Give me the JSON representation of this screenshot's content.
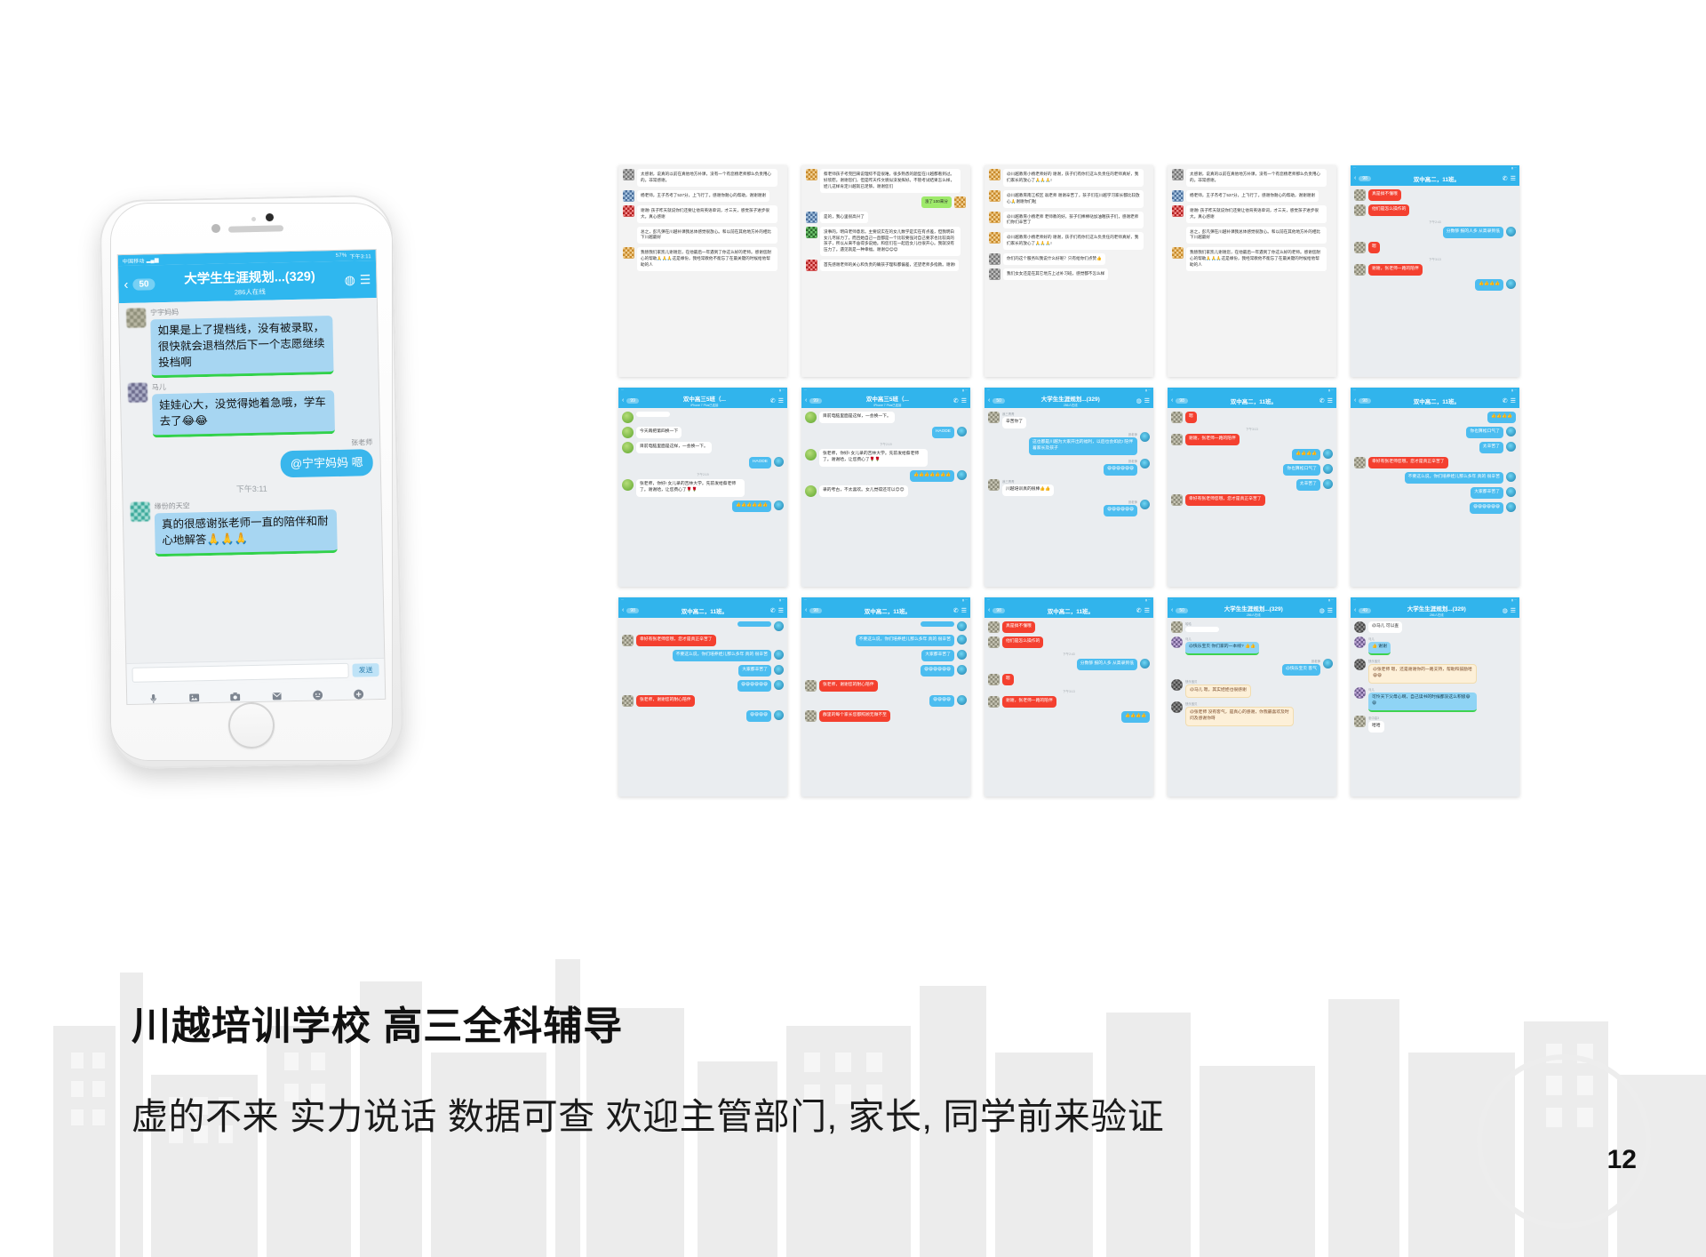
{
  "slide": {
    "headline": "川越培训学校 高三全科辅导",
    "subline": "虚的不来 实力说话 数据可查 欢迎主管部门, 家长, 同学前来验证",
    "page_number": "12",
    "accent_blue": "#2fb7ef",
    "bubble_red": "#f4402f",
    "bubble_green": "#32d14a"
  },
  "phone": {
    "status": {
      "carrier": "中国移动",
      "battery": "57%",
      "time": "下午3:11"
    },
    "nav": {
      "back_icon": "chevron-left",
      "badge": "50",
      "title": "大学生生涯规划...(329)",
      "subtitle": "286人在线",
      "right_icon_1": "leaf-icon",
      "right_icon_2": "menu-icon"
    },
    "messages": [
      {
        "side": "left",
        "name": "宁宇妈妈",
        "text": "如果是上了提档线，没有被录取，很快就会退档然后下一个志愿继续投档啊"
      },
      {
        "side": "left",
        "name": "马儿",
        "text": "娃娃心大，没觉得她着急哦，学车去了😂😂"
      },
      {
        "side": "right",
        "name": "张老师",
        "text": "@宁宇妈妈 嗯"
      },
      {
        "side": "time",
        "text": "下午3:11"
      },
      {
        "side": "left",
        "name": "缘份的天空",
        "text": "真的很感谢张老师一直的陪伴和耐心地解答🙏🙏🙏"
      }
    ],
    "input": {
      "placeholder": "",
      "send_label": "发送"
    },
    "toolbar_icons": [
      "mic-icon",
      "image-icon",
      "camera-icon",
      "envelope-icon",
      "smiley-icon",
      "plus-icon"
    ]
  },
  "grid": {
    "row1": [
      {
        "type": "white",
        "bubbles": [
          {
            "av": "gy",
            "text": "太感谢，说真的以前在真他地方补课，没有一个有您杨老师那么负责用心的。非常感谢。"
          },
          {
            "av": "bl",
            "text": "杨老师，王子杰考了537分，上飞行了。感谢你耐心的帮助，谢谢谢谢"
          },
          {
            "av": "r",
            "text": "谢谢! 孩子昨天就说你们还要让他背英语单词，才三天，感觉孩子进步很大。真心感谢"
          },
          {
            "av": "none",
            "text": "总之，彭凡彈在川越补课我总体感觉很放心。和以前在其他地方补的相比下川越最好"
          },
          {
            "av": "o",
            "text": "我替我们家凯儿谢谢您，在他最后一年遇到了你这么好的老师。感谢您耐心的帮助🙏🙏🙏这是缘份，我经常教他不能忘了在最关键的时候给他帮助的人"
          }
        ]
      },
      {
        "type": "white",
        "bubbles": [
          {
            "av": "o",
            "text": "蔡老师孩子考完回来说理综不是很难，很多熟悉的题型在川越都看到过。好欣慰。谢谢您们，但是昨天作文貌似没发挥好。不管考试结果怎么样，娃儿这样肯定川越就已足够。谢谢您们"
          },
          {
            "av": "none",
            "side": "right",
            "green": true,
            "text": "涨了100来分"
          },
          {
            "av": "bl",
            "text": "是的，我心里很高兴了"
          },
          {
            "av": "g",
            "text": "没事的，明白老师意思。主要说实在的女儿数学是实在有点差，但我明白女儿尽尿力了。而且她自己一直都是一个比较要强对自己要求也比较高的孩子，所以从来不舍得多说她。和您们在一起后女儿也很开心。我就没有压力了。遇见就是一种幸福。谢谢😊😊😊"
          },
          {
            "av": "r",
            "text": "首先感谢老师的关心和负责的确孩子理科都偏差，还望老师多指教。谢谢!"
          }
        ]
      },
      {
        "type": "white",
        "bubbles": [
          {
            "av": "o",
            "text": "@川越教育小杨老师好的 谢谢，孩子们有你们这么负责任的老师真好，我们家长的放心了🙏🙏🙏!"
          },
          {
            "av": "o",
            "text": "@川越教育南江校区 翁老师 谢谢辛苦了，孩子们在川越学习家长都比较放心🙏谢谢你们啦"
          },
          {
            "av": "o",
            "text": "@川越教育小杨老师 老师教的好，孩子们棒棒哒加油喔孩子们，感谢老师们你们辛苦了"
          },
          {
            "av": "o",
            "text": "@川越教育小杨老师好的 谢谢，孩子们有你们这么负责任的老师真好，我们家长的放心了🙏🙏🙏!"
          },
          {
            "av": "gy",
            "text": "你们的这个服务叫我说什么好呢？只有给你们点赞👍"
          },
          {
            "av": "gy",
            "text": "我们女女还是在其它地方上过补习班，感觉都不怎么样"
          }
        ]
      },
      {
        "type": "white",
        "bubbles": [
          {
            "av": "gy",
            "text": "太感谢，说真的以前在真他地方补课，没有一个有您杨老师那么负责用心的。非常感谢。"
          },
          {
            "av": "bl",
            "text": "杨老师，王子杰考了537分，上飞行了。感谢你耐心的帮助，谢谢谢谢"
          },
          {
            "av": "r",
            "text": "谢谢! 孩子昨天就说你们还要让他背英语单词，才三天，感觉孩子进步很大。真心感谢"
          },
          {
            "av": "none",
            "text": "总之，彭凡彈在川越补课我总体感觉很放心。和以前在其他地方补的相比下川越最好"
          },
          {
            "av": "o",
            "text": "我替我们家凯儿谢谢您，在他最后一年遇到了你这么好的老师。感谢您耐心的帮助🙏🙏🙏这是缘份，我经常教他不能忘了在最关键的时候给他帮助的人"
          }
        ]
      },
      {
        "type": "blue",
        "nav": {
          "badge": "98",
          "title": "双中高二，11班。",
          "sub": "",
          "ic1": "phone-icon",
          "ic2": "menu-icon"
        },
        "msgs": [
          {
            "s": "l",
            "style": "red",
            "av": "def",
            "text": "真是搞不懂哦"
          },
          {
            "s": "l",
            "style": "red",
            "av": "def",
            "text": "他们是怎么操作的"
          },
          {
            "s": "t",
            "text": "下午2:43"
          },
          {
            "s": "r",
            "style": "blue",
            "seal": true,
            "text": "分数够 报的人多 从高录到低"
          },
          {
            "s": "l",
            "style": "red",
            "av": "def",
            "text": "嗯"
          },
          {
            "s": "t",
            "text": "下午3:13"
          },
          {
            "s": "l",
            "style": "red",
            "av": "def",
            "text": "谢谢，张老师一路的陪伴"
          },
          {
            "s": "r",
            "style": "blue",
            "seal": true,
            "text": "👍👍👍👍"
          }
        ]
      }
    ],
    "row2": [
      {
        "type": "blue",
        "nav": {
          "badge": "99",
          "title": "双中高三5班（...",
          "sub": "iPhone 7 Plus已连接",
          "ic1": "phone-icon",
          "ic2": "menu-icon"
        },
        "msgs": [
          {
            "s": "l",
            "style": "white",
            "av": "leaf",
            "text": ""
          },
          {
            "s": "l",
            "style": "white",
            "av": "leaf",
            "text": "今天再把第四换一下"
          },
          {
            "s": "l",
            "style": "white",
            "av": "leaf",
            "text": "目前电脑里面是这样，一会换一下。"
          },
          {
            "s": "r",
            "style": "blue",
            "seal": true,
            "text": "HAODE"
          },
          {
            "s": "t",
            "text": "下午2:19"
          },
          {
            "s": "l",
            "style": "white",
            "av": "leaf",
            "text": "张老师，你好! 女儿录的吉林大学。先前发给蔡老师了。谢谢哈，让您费心了🌹🌹"
          },
          {
            "s": "r",
            "style": "blue",
            "seal": true,
            "text": "👍👍👍👍👍👍"
          }
        ]
      },
      {
        "type": "blue",
        "nav": {
          "badge": "99",
          "title": "双中高三5班（...",
          "sub": "iPhone 7 Plus已连接",
          "ic1": "phone-icon",
          "ic2": "menu-icon"
        },
        "msgs": [
          {
            "s": "l",
            "style": "white",
            "av": "leaf",
            "text": "目前电脑里面是这样，一会换一下。"
          },
          {
            "s": "r",
            "style": "blue",
            "seal": true,
            "text": "HAODE"
          },
          {
            "s": "t",
            "text": "下午2:19"
          },
          {
            "s": "l",
            "style": "white",
            "av": "leaf",
            "text": "张老师，你好! 女儿录的吉林大学。先前发给蔡老师了。谢谢哈，让您费心了🌹🌹"
          },
          {
            "s": "r",
            "style": "blue",
            "seal": true,
            "text": "👍👍👍👍👍👍👍"
          },
          {
            "s": "l",
            "style": "white",
            "av": "leaf",
            "text": "录的考古，不太喜欢。女儿觉得还可以😊😊"
          }
        ]
      },
      {
        "type": "blue",
        "nav": {
          "badge": "50",
          "title": "大学生生涯规划...(329)",
          "sub": "286人在线",
          "ic1": "leaf-icon",
          "ic2": "menu-icon"
        },
        "msgs": [
          {
            "s": "l",
            "style": "white",
            "av": "def",
            "nm": "我三青青",
            "text": "辛苦你了"
          },
          {
            "s": "r",
            "style": "blue",
            "nm": "张老师",
            "seal": true,
            "text": "这也都是川越为大家开出的福利，以后也会如此! 陪伴着家长及孩子"
          },
          {
            "s": "r",
            "style": "blue",
            "nm": "张老师",
            "seal": true,
            "text": "😄😄😄😄😄😄"
          },
          {
            "s": "l",
            "style": "white",
            "av": "def",
            "nm": "我三青青",
            "text": "川越培训真的很棒👍👍"
          },
          {
            "s": "r",
            "style": "blue",
            "nm": "张老师",
            "seal": true,
            "text": "😄😄😄😄😄😄"
          }
        ]
      },
      {
        "type": "blue",
        "nav": {
          "badge": "98",
          "title": "双中高二，11班。",
          "sub": "",
          "ic1": "phone-icon",
          "ic2": "menu-icon"
        },
        "msgs": [
          {
            "s": "l",
            "style": "red",
            "av": "def",
            "text": "嗯"
          },
          {
            "s": "t",
            "text": "下午3:13"
          },
          {
            "s": "l",
            "style": "red",
            "av": "def",
            "text": "谢谢，张老师一路的陪伴"
          },
          {
            "s": "r",
            "style": "blue",
            "seal": true,
            "text": "👍👍👍👍"
          },
          {
            "s": "r",
            "style": "blue",
            "seal": true,
            "text": "你也算松口气了"
          },
          {
            "s": "r",
            "style": "blue",
            "seal": true,
            "text": "太辛苦了"
          },
          {
            "s": "l",
            "style": "red",
            "av": "def",
            "text": "幸好有张老师您哦，您才是真正辛苦了"
          }
        ]
      },
      {
        "type": "blue",
        "nav": {
          "badge": "98",
          "title": "双中高二，11班。",
          "sub": "",
          "ic1": "phone-icon",
          "ic2": "menu-icon"
        },
        "msgs": [
          {
            "s": "r",
            "style": "blue",
            "seal": false,
            "text": "👍👍👍👍"
          },
          {
            "s": "r",
            "style": "blue",
            "seal": true,
            "text": "你也算松口气了"
          },
          {
            "s": "r",
            "style": "blue",
            "seal": true,
            "text": "太辛苦了"
          },
          {
            "s": "l",
            "style": "red",
            "av": "def",
            "text": "幸好有张老师您哦，您才是真正辛苦了"
          },
          {
            "s": "r",
            "style": "blue",
            "seal": true,
            "text": "不要这么说，你们培养娃儿那么多年 真的 很辛苦"
          },
          {
            "s": "r",
            "style": "blue",
            "seal": true,
            "text": "大家都辛苦了"
          },
          {
            "s": "r",
            "style": "blue",
            "seal": true,
            "text": "😄😄😄😄😄😄"
          }
        ]
      }
    ],
    "row3": [
      {
        "type": "blue",
        "nav": {
          "badge": "98",
          "title": "双中高二，11班。",
          "sub": "",
          "ic1": "phone-icon",
          "ic2": "menu-icon"
        },
        "msgs": [
          {
            "s": "r",
            "style": "blue",
            "seal": true,
            "text": ""
          },
          {
            "s": "l",
            "style": "red",
            "av": "def",
            "text": "幸好有张老师您哦，您才是真正辛苦了"
          },
          {
            "s": "r",
            "style": "blue",
            "seal": true,
            "text": "不要这么说，你们培养娃儿那么多年 真的 很辛苦"
          },
          {
            "s": "r",
            "style": "blue",
            "seal": true,
            "text": "大家都辛苦了"
          },
          {
            "s": "r",
            "style": "blue",
            "seal": true,
            "text": "😄😄😄😄😄😄"
          },
          {
            "s": "l",
            "style": "red",
            "av": "def",
            "text": "张老师，谢谢您的耐心陪伴"
          },
          {
            "s": "r",
            "style": "blue",
            "seal": true,
            "text": "😄😄😄😄"
          }
        ]
      },
      {
        "type": "blue",
        "nav": {
          "badge": "98",
          "title": "双中高二，11班。",
          "sub": "",
          "ic1": "phone-icon",
          "ic2": "menu-icon"
        },
        "msgs": [
          {
            "s": "r",
            "style": "blue",
            "seal": true,
            "text": ""
          },
          {
            "s": "r",
            "style": "blue",
            "seal": true,
            "text": "不要这么说，你们培养娃儿那么多年 真的 很辛苦"
          },
          {
            "s": "r",
            "style": "blue",
            "seal": true,
            "text": "大家都辛苦了"
          },
          {
            "s": "r",
            "style": "blue",
            "seal": true,
            "text": "😄😄😄😄😄😄"
          },
          {
            "s": "l",
            "style": "red",
            "av": "def",
            "text": "张老师，谢谢您的耐心陪伴"
          },
          {
            "s": "r",
            "style": "blue",
            "seal": true,
            "text": "😄😄😄😄"
          },
          {
            "s": "l",
            "style": "red",
            "av": "def",
            "text": "群里的每个家长您都照顾无微不至"
          }
        ]
      },
      {
        "type": "blue",
        "nav": {
          "badge": "98",
          "title": "双中高二，11班。",
          "sub": "",
          "ic1": "phone-icon",
          "ic2": "menu-icon"
        },
        "msgs": [
          {
            "s": "l",
            "style": "red",
            "av": "def",
            "text": "真是搞不懂哦"
          },
          {
            "s": "l",
            "style": "red",
            "av": "def",
            "text": "他们是怎么操作的"
          },
          {
            "s": "t",
            "text": "下午2:43"
          },
          {
            "s": "r",
            "style": "blue",
            "seal": true,
            "text": "分数够 报的人多 从高录到低"
          },
          {
            "s": "l",
            "style": "red",
            "av": "def",
            "text": "嗯"
          },
          {
            "s": "t",
            "text": "下午3:13"
          },
          {
            "s": "l",
            "style": "red",
            "av": "def",
            "text": "谢谢，张老师一路的陪伴"
          },
          {
            "s": "r",
            "style": "blue",
            "seal": false,
            "text": "👍👍👍👍"
          }
        ]
      },
      {
        "type": "blue",
        "nav": {
          "badge": "50",
          "title": "大学生生涯规划...(329)",
          "sub": "286人在线",
          "ic1": "leaf-icon",
          "ic2": "menu-icon"
        },
        "msgs": [
          {
            "s": "l",
            "style": "white",
            "av": "def",
            "nm": "哈哈",
            "text": ""
          },
          {
            "s": "l",
            "style": "bluelite",
            "av": "pur",
            "nm": "马儿",
            "text": "@快乐宝贝 你们家的一本线? 👍👍"
          },
          {
            "s": "r",
            "style": "blue",
            "nm": "张老师",
            "seal": true,
            "text": "@快乐宝贝 客气"
          },
          {
            "s": "l",
            "style": "cream",
            "av": "dk",
            "nm": "快乐宝贝",
            "text": "@马儿 嗯，其实娃娃也很感谢"
          },
          {
            "s": "l",
            "style": "cream",
            "av": "dk",
            "nm": "快乐宝贝",
            "text": "@张老师 没有客气，是真心的感谢，你我最喜欢及时问及感谢你呀"
          }
        ]
      },
      {
        "type": "blue",
        "nav": {
          "badge": "49",
          "title": "大学生生涯规划...(329)",
          "sub": "286人在线",
          "ic1": "leaf-icon",
          "ic2": "menu-icon"
        },
        "msgs": [
          {
            "s": "l",
            "style": "white",
            "av": "dk",
            "text": "@马儿 可以查"
          },
          {
            "s": "l",
            "style": "bluelite",
            "av": "pur",
            "nm": "马儿",
            "text": "👍 谢谢"
          },
          {
            "s": "l",
            "style": "cream",
            "av": "dk",
            "nm": "快乐宝贝",
            "text": "@张老师 嗯，还是谢谢你的一路支持，帮助和鼓励哈 😄😄"
          },
          {
            "s": "l",
            "style": "bluelite",
            "av": "pur",
            "nm": "马儿",
            "text": "可怜天下父母心啊，自己读书的时候都没这么积极😄😄"
          },
          {
            "s": "l",
            "style": "white",
            "av": "def",
            "nm": "忠中高3",
            "text": "哈哈"
          }
        ]
      }
    ]
  }
}
